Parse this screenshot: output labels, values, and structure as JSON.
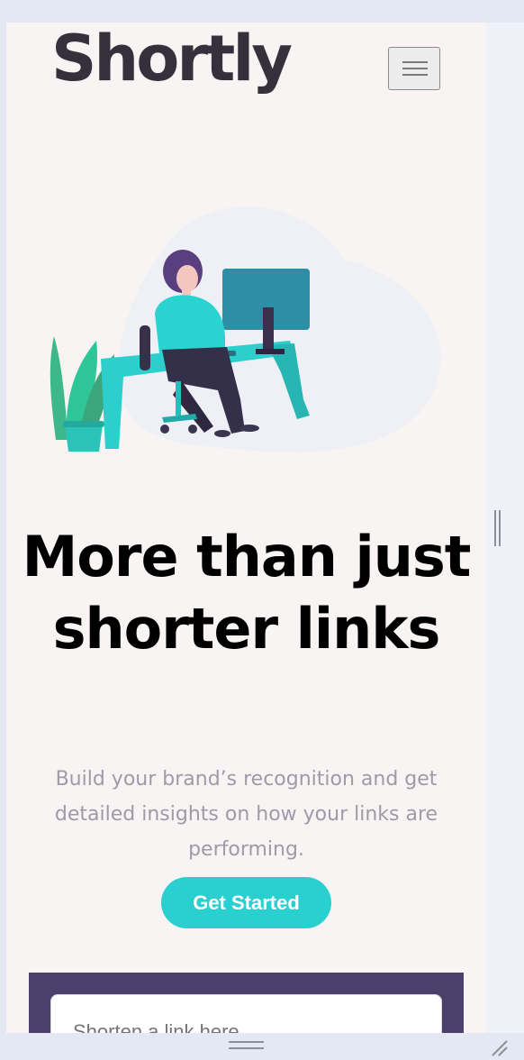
{
  "header": {
    "logo": "Shortly",
    "menu_icon": "hamburger-menu-icon"
  },
  "hero": {
    "illustration": "person-working-at-desk-illustration",
    "headline": "More than just shorter links",
    "subtext": "Build your brand’s recognition and get detailed insights on how your links are performing.",
    "cta_label": "Get Started"
  },
  "shorten": {
    "placeholder": "Shorten a link here..."
  },
  "colors": {
    "background": "#f8f4f3",
    "logo": "#34313d",
    "cta": "#2acfcf",
    "panel": "#4b3f6b",
    "subtext": "#9e9aa7"
  }
}
